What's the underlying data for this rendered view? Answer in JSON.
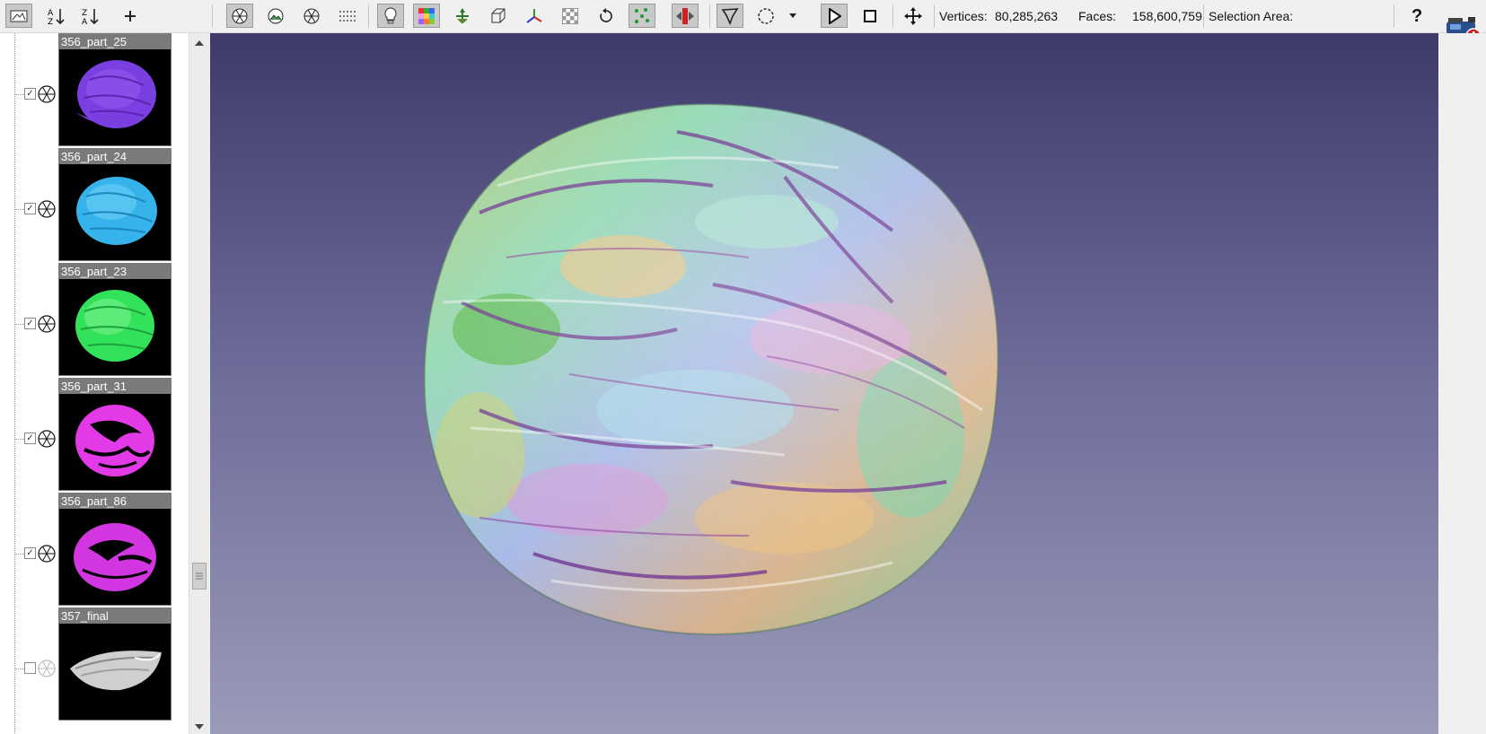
{
  "toolbar": {
    "left_icons": [
      "snapshot-icon",
      "sort-ascending-icon",
      "sort-descending-icon",
      "add-icon"
    ],
    "tools": [
      "wireframe-icon",
      "textured-mesh-icon",
      "points-icon",
      "dot-grid-icon",
      "lighting-icon",
      "color-grid-icon",
      "normals-icon",
      "bounding-box-icon",
      "axes-icon",
      "checker-texture-icon",
      "rotate-icon",
      "vertex-select-icon",
      "record-icon",
      "polygon-select-icon",
      "circle-select-icon",
      "dropdown-icon",
      "play-icon",
      "stop-icon",
      "move-icon"
    ],
    "active_tools": [
      "snapshot-icon",
      "wireframe-icon",
      "lighting-icon",
      "color-grid-icon",
      "vertex-select-icon",
      "record-icon",
      "polygon-select-icon",
      "play-icon"
    ],
    "vertices_label": "Vertices:",
    "vertices_value": "80,285,263",
    "faces_label": "Faces:",
    "faces_value": "158,600,759",
    "selection_label": "Selection Area:",
    "selection_value": "",
    "help_label": "?"
  },
  "layers": [
    {
      "name": "356_part_25",
      "checked": true,
      "visible": true,
      "color": "#7a3fe0",
      "shape": "full-shell"
    },
    {
      "name": "356_part_24",
      "checked": true,
      "visible": true,
      "color": "#35b3ea",
      "shape": "full-shell"
    },
    {
      "name": "356_part_23",
      "checked": true,
      "visible": true,
      "color": "#32e25a",
      "shape": "full-shell"
    },
    {
      "name": "356_part_31",
      "checked": true,
      "visible": true,
      "color": "#e23ae6",
      "shape": "cross-section"
    },
    {
      "name": "356_part_86",
      "checked": true,
      "visible": true,
      "color": "#d236e0",
      "shape": "cross-section"
    },
    {
      "name": "357_final",
      "checked": false,
      "visible": false,
      "color": "#cfcfcf",
      "shape": "half-shell"
    }
  ],
  "colors": {
    "viewport_top": "#3e3a6c",
    "viewport_bottom": "#9a9ab9",
    "panel_header": "#7a7a7a",
    "alert": "#d0202a"
  }
}
